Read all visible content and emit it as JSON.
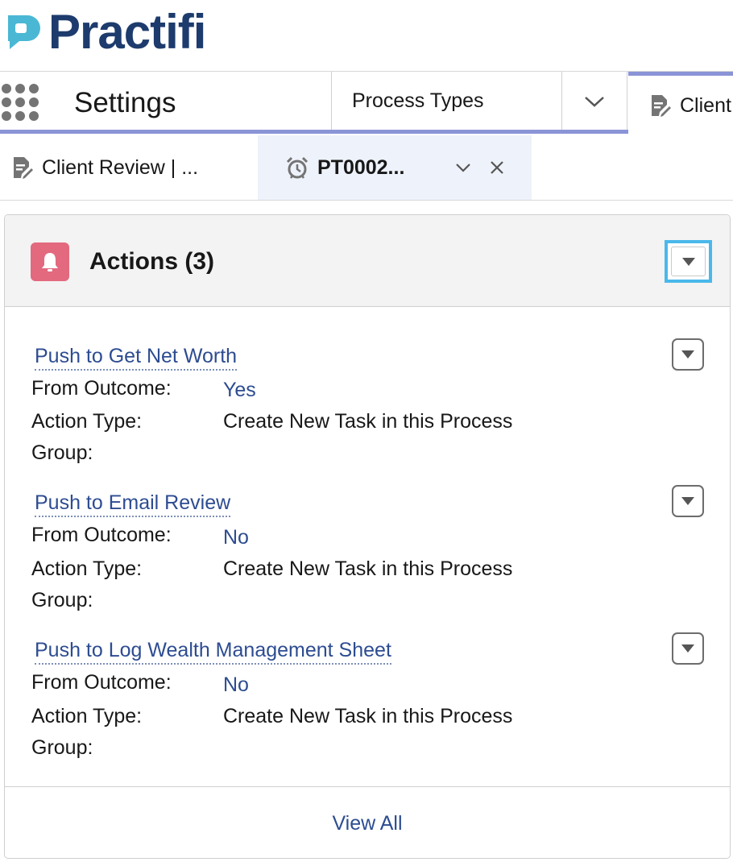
{
  "brand": {
    "name": "Practifi",
    "color": "#1d3b6d",
    "accent": "#4ab8d4"
  },
  "navbar": {
    "app_name": "Settings",
    "items": [
      {
        "label": "Process Types"
      }
    ],
    "active_tab": {
      "label": "Client",
      "icon": "document-edit-icon"
    },
    "accent": "#8a94d6"
  },
  "subtabs": [
    {
      "label": "Client Review | ...",
      "icon": "document-edit-icon"
    },
    {
      "label": "PT0002...",
      "icon": "alarm-clock-icon",
      "active": true
    }
  ],
  "card": {
    "title": "Actions (3)",
    "icon": "bell-icon",
    "icon_color": "#e3697f",
    "actions": [
      {
        "name": "Push to Get Net Worth",
        "from_outcome_label": "From Outcome:",
        "from_outcome": "Yes",
        "action_type_label": "Action Type:",
        "action_type": "Create New Task in this Process",
        "group_label": "Group:",
        "group": ""
      },
      {
        "name": "Push to Email Review",
        "from_outcome_label": "From Outcome:",
        "from_outcome": "No",
        "action_type_label": "Action Type:",
        "action_type": "Create New Task in this Process",
        "group_label": "Group:",
        "group": ""
      },
      {
        "name": "Push to Log Wealth Management Sheet",
        "from_outcome_label": "From Outcome:",
        "from_outcome": "No",
        "action_type_label": "Action Type:",
        "action_type": "Create New Task in this Process",
        "group_label": "Group:",
        "group": ""
      }
    ],
    "footer_link": "View All"
  }
}
